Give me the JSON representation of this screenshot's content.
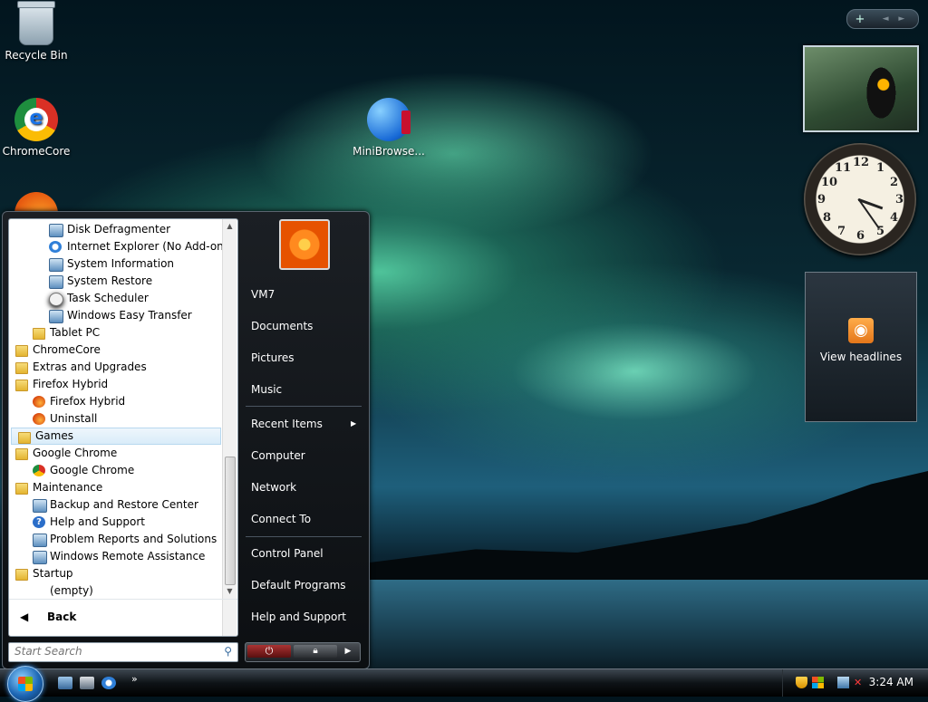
{
  "desktop": {
    "icons": [
      {
        "label": "Recycle Bin"
      },
      {
        "label": "ChromeCore"
      },
      {
        "label": "MiniBrowse..."
      }
    ]
  },
  "gadgets": {
    "toolbar_plus": "+",
    "toolbar_arrows": "◄ ►",
    "clock_numbers": [
      "12",
      "1",
      "2",
      "3",
      "4",
      "5",
      "6",
      "7",
      "8",
      "9",
      "10",
      "11"
    ],
    "headlines_label": "View headlines",
    "headlines_icon": "rss-icon"
  },
  "start_menu": {
    "programs": [
      {
        "label": "Disk Defragmenter",
        "icon": "app"
      },
      {
        "label": "Internet Explorer (No Add-ons)",
        "icon": "ie"
      },
      {
        "label": "System Information",
        "icon": "app"
      },
      {
        "label": "System Restore",
        "icon": "app"
      },
      {
        "label": "Task Scheduler",
        "icon": "clock"
      },
      {
        "label": "Windows Easy Transfer",
        "icon": "app"
      },
      {
        "label": "Tablet PC",
        "icon": "folder"
      },
      {
        "label": "ChromeCore",
        "icon": "folder"
      },
      {
        "label": "Extras and Upgrades",
        "icon": "folder"
      },
      {
        "label": "Firefox Hybrid",
        "icon": "folder"
      },
      {
        "label": "Firefox Hybrid",
        "icon": "ff"
      },
      {
        "label": "Uninstall",
        "icon": "ff"
      },
      {
        "label": "Games",
        "icon": "folder"
      },
      {
        "label": "Google Chrome",
        "icon": "folder"
      },
      {
        "label": "Google Chrome",
        "icon": "gc"
      },
      {
        "label": "Maintenance",
        "icon": "folder"
      },
      {
        "label": "Backup and Restore Center",
        "icon": "app"
      },
      {
        "label": "Help and Support",
        "icon": "help"
      },
      {
        "label": "Problem Reports and Solutions",
        "icon": "app"
      },
      {
        "label": "Windows Remote Assistance",
        "icon": "app"
      },
      {
        "label": "Startup",
        "icon": "folder"
      },
      {
        "label": "(empty)",
        "icon": ""
      }
    ],
    "back_label": "Back",
    "search_placeholder": "Start Search",
    "user_name": "VM7",
    "right_items": {
      "documents": "Documents",
      "pictures": "Pictures",
      "music": "Music",
      "recent": "Recent Items",
      "computer": "Computer",
      "network": "Network",
      "connect": "Connect To",
      "control_panel": "Control Panel",
      "default_programs": "Default Programs",
      "help": "Help and Support"
    }
  },
  "taskbar": {
    "time": "3:24 AM",
    "chevron": "»"
  }
}
